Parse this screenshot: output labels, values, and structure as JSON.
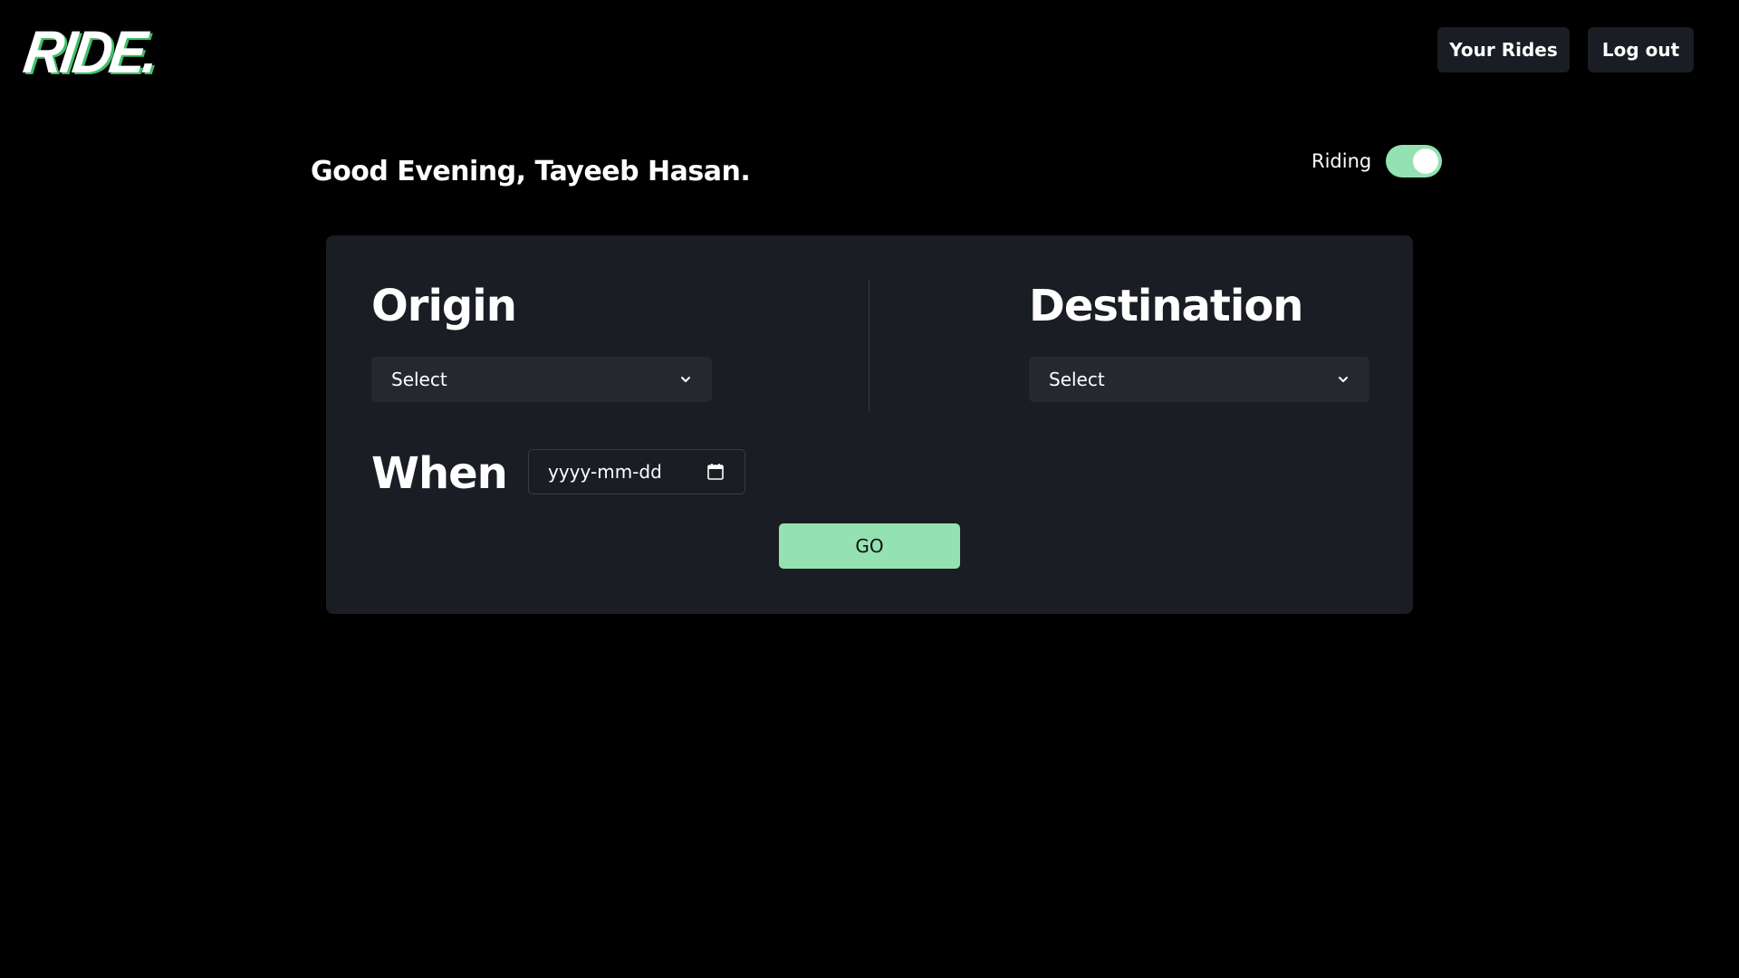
{
  "brand": {
    "logo_text": "RIDE.",
    "accent_color": "#94e2b1"
  },
  "nav": {
    "your_rides_label": "Your Rides",
    "logout_label": "Log out"
  },
  "greeting": "Good Evening, Tayeeb Hasan.",
  "riding_toggle": {
    "label": "Riding",
    "on": true
  },
  "form": {
    "origin": {
      "heading": "Origin",
      "select_value": "Select",
      "icon": "chevron-down-icon"
    },
    "destination": {
      "heading": "Destination",
      "select_value": "Select",
      "icon": "chevron-down-icon"
    },
    "when": {
      "heading": "When",
      "date_placeholder": "yyyy-mm-dd",
      "icon": "calendar-icon"
    },
    "submit_label": "GO"
  }
}
